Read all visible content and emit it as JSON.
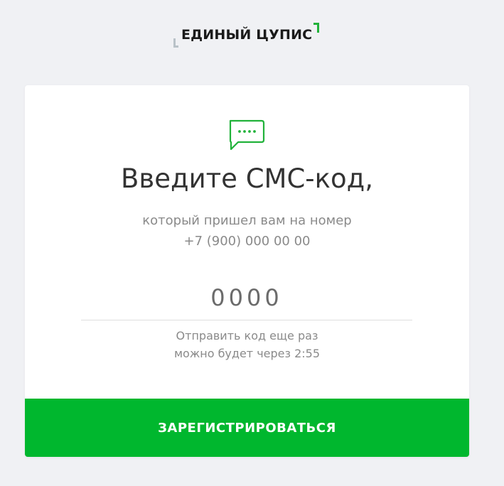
{
  "logo": {
    "text": "ЕДИНЫЙ ЦУПИС"
  },
  "form": {
    "title": "Введите СМС-код,",
    "subtitle_line1": "который пришел вам на номер",
    "phone": "+7 (900) 000 00 00",
    "code_placeholder": "0000",
    "resend_line1": "Отправить код еще раз",
    "resend_line2": "можно будет через 2:55",
    "submit_label": "ЗАРЕГИСТРИРОВАТЬСЯ"
  },
  "icons": {
    "sms": "sms-icon"
  },
  "colors": {
    "accent": "#00b72e",
    "background": "#f0f1f4"
  }
}
